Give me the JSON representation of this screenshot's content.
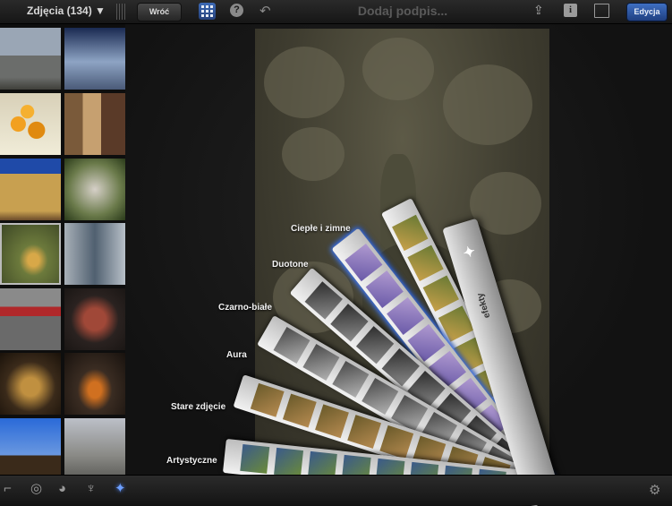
{
  "topbar": {
    "album_title": "Zdjęcia (134) ▼",
    "back_label": "Wróć",
    "caption_placeholder": "Dodaj podpis...",
    "edit_label": "Edycja",
    "info_glyph": "i",
    "help_glyph": "?"
  },
  "icons": {
    "undo": "↶",
    "share": "⇪",
    "gear": "⚙"
  },
  "effects_fan": {
    "handle_label": "efekty",
    "labels": [
      "Ciepłe i zimne",
      "Duotone",
      "Czarno-białe",
      "Aura",
      "Stare zdjęcie",
      "Artystyczne"
    ],
    "selected_index": 1
  },
  "toolbar": {
    "tools": [
      "crop",
      "exposure",
      "color",
      "brush",
      "effects"
    ],
    "active_tool": "effects"
  },
  "colors": {
    "accent": "#3f7bff",
    "active_button": "#2f5aa8"
  }
}
